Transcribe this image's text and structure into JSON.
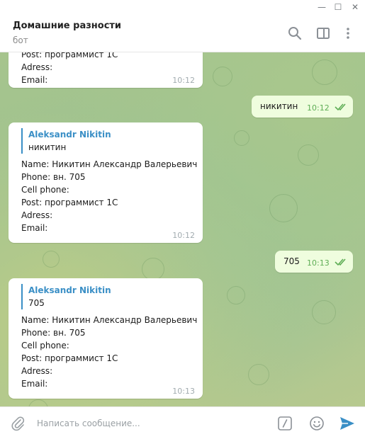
{
  "window": {
    "minimize_glyph": "—",
    "maximize_glyph": "☐",
    "close_glyph": "✕"
  },
  "header": {
    "title": "Домашние разности",
    "subtitle": "бот",
    "icons": [
      "search-icon",
      "side-panel-icon",
      "more-vertical-icon"
    ]
  },
  "messages": {
    "top_partial": {
      "cut_line": "Post: программист 1С",
      "adress": "Adress:",
      "email": "Email:",
      "time": "10:12"
    },
    "out1": {
      "text": "никитин",
      "time": "10:12",
      "status": "read"
    },
    "card1": {
      "reply_name": "Aleksandr Nikitin",
      "reply_text": "никитин",
      "name": "Name: Никитин Александр Валерьевич",
      "phone": "Phone: вн. 705",
      "cell": "Cell phone:",
      "post": "Post: программист 1С",
      "adress": "Adress:",
      "email": "Email:",
      "time": "10:12"
    },
    "out2": {
      "text": "705",
      "time": "10:13",
      "status": "read"
    },
    "card2": {
      "reply_name": "Aleksandr Nikitin",
      "reply_text": "705",
      "name": "Name: Никитин Александр Валерьевич",
      "phone": "Phone: вн. 705",
      "cell": "Cell phone:",
      "post": "Post: программист 1С",
      "adress": "Adress:",
      "email": "Email:",
      "time": "10:13"
    }
  },
  "composer": {
    "placeholder": "Написать сообщение...",
    "icons": [
      "paperclip-icon",
      "bot-command-icon",
      "emoji-icon",
      "send-icon"
    ]
  },
  "colors": {
    "accent": "#3a8fc6",
    "outgoing_bubble": "#effdde",
    "read_check": "#5fae56",
    "send": "#3a8fc6"
  }
}
